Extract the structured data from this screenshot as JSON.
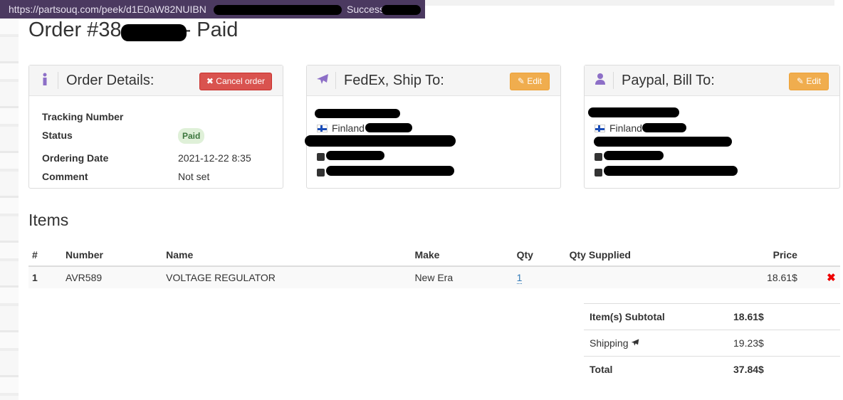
{
  "browser": {
    "url": "https://partsouq.com/peek/d1E0aW82NUIBN",
    "url_tail": "Success"
  },
  "page": {
    "title_prefix": "Order #38",
    "title_suffix": "- Paid"
  },
  "order_details": {
    "title": "Order Details:",
    "cancel_label": "Cancel order",
    "rows": [
      {
        "label": "Tracking Number",
        "value": ""
      },
      {
        "label": "Status",
        "value": "Paid"
      },
      {
        "label": "Ordering Date",
        "value": "2021-12-22 8:35"
      },
      {
        "label": "Comment",
        "value": "Not set"
      }
    ]
  },
  "ship_to": {
    "title": "FedEx, Ship To:",
    "edit_label": "Edit",
    "country": "Finland"
  },
  "bill_to": {
    "title": "Paypal, Bill To:",
    "edit_label": "Edit",
    "country": "Finland"
  },
  "items": {
    "title": "Items",
    "columns": [
      "#",
      "Number",
      "Name",
      "Make",
      "Qty",
      "Qty Supplied",
      "Price"
    ],
    "rows": [
      {
        "index": "1",
        "number": "AVR589",
        "name": "VOLTAGE REGULATOR",
        "make": "New Era",
        "qty": "1",
        "qty_supplied": "",
        "price": "18.61$"
      }
    ]
  },
  "totals": {
    "subtotal_label": "Item(s) Subtotal",
    "subtotal_value": "18.61$",
    "shipping_label": "Shipping",
    "shipping_value": "19.23$",
    "total_label": "Total",
    "total_value": "37.84$"
  },
  "colors": {
    "accent_purple": "#8d6fc7",
    "danger": "#d9534f",
    "warning": "#f0ad4e",
    "paid_bg": "#dff0d8"
  },
  "icons": {
    "info": "info-icon",
    "plane": "plane-icon",
    "user": "user-icon",
    "pencil": "pencil-icon",
    "times": "times-icon"
  }
}
